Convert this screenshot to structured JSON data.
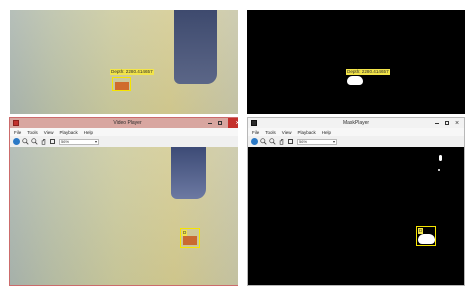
{
  "top_left": {
    "depth_label": "Depth: 2280.414657"
  },
  "top_right": {
    "depth_label": "Depth: 2280.414657"
  },
  "video_player": {
    "title": "Video Player",
    "menu": [
      "File",
      "Tools",
      "View",
      "Playback",
      "Help"
    ],
    "zoom_value": "56%",
    "depth_label": "D"
  },
  "mask_player": {
    "title": "MaskPlayer",
    "menu": [
      "File",
      "Tools",
      "View",
      "Playback",
      "Help"
    ],
    "zoom_value": "56%",
    "depth_label": "D"
  },
  "colors": {
    "video_titlebar": "#d8a6a0",
    "mask_titlebar": "#f2f2f2",
    "close_red": "#c4302b",
    "box_yellow": "#f6e400"
  }
}
